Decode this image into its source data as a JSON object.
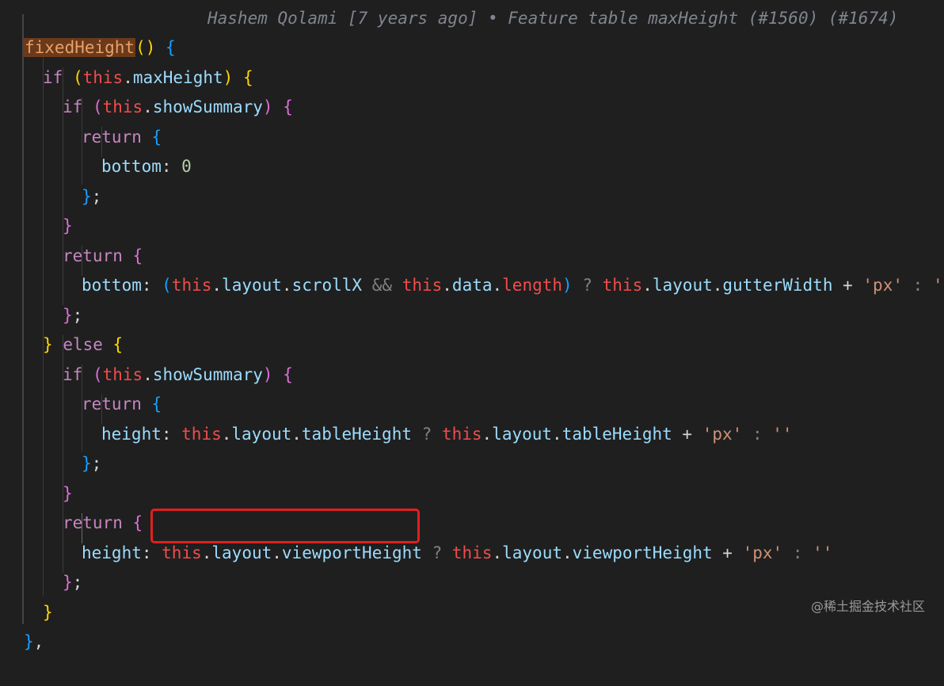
{
  "blame": {
    "text": "Hashem Qolami [7 years ago] • Feature table maxHeight (#1560) (#1674)"
  },
  "code": {
    "function_name": "fixedHeight",
    "lines": [
      "fixedHeight() {",
      "if (this.maxHeight) {",
      "if (this.showSummary) {",
      "return {",
      "bottom: 0",
      "};",
      "}",
      "return {",
      "bottom: (this.layout.scrollX && this.data.length) ? this.layout.gutterWidth + 'px' : ''",
      "};",
      "} else {",
      "if (this.showSummary) {",
      "return {",
      "height: this.layout.tableHeight ? this.layout.tableHeight + 'px' : ''",
      "};",
      "}",
      "return {",
      "height: this.layout.viewportHeight ? this.layout.viewportHeight + 'px' : ''",
      "};",
      "}",
      "},"
    ]
  },
  "highlight": {
    "text": "this.layout.viewportHeight"
  },
  "watermark": {
    "text": "@稀土掘金技术社区"
  },
  "colors": {
    "background": "#1f1f1f",
    "keyword": "#c586c0",
    "this": "#f14c4c",
    "property": "#4fc1ff",
    "string": "#ce9178",
    "number": "#b5cea8",
    "highlight_border": "#e02020"
  }
}
